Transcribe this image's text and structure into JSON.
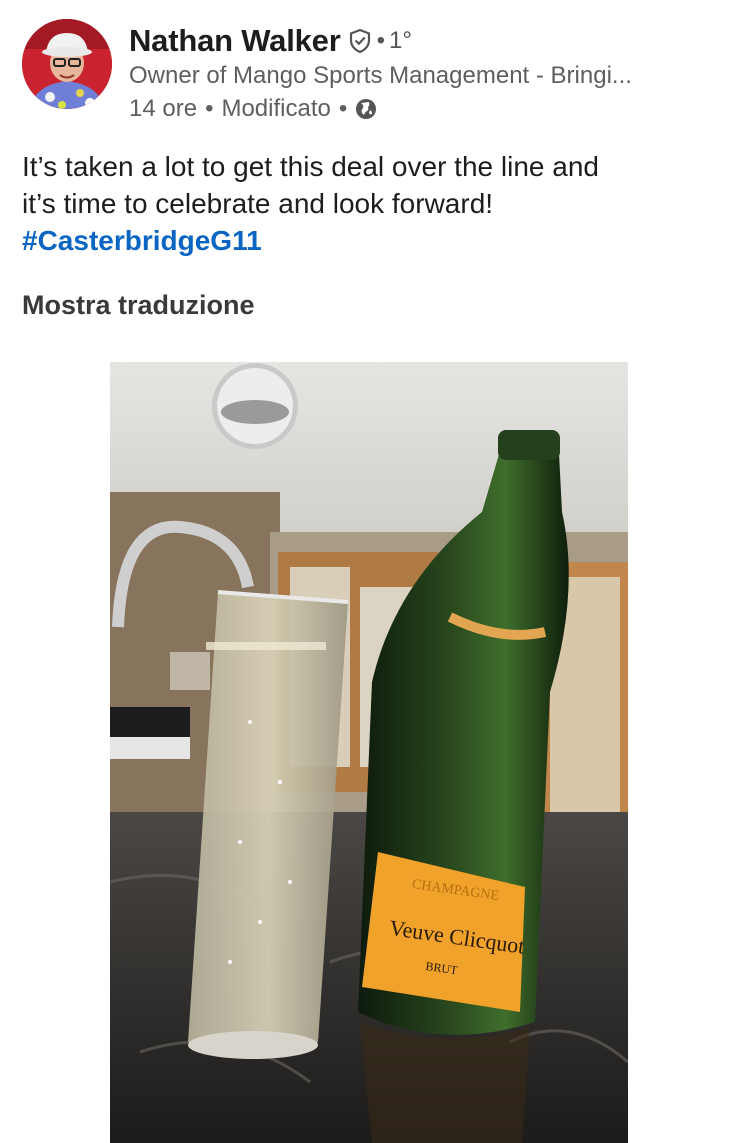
{
  "post": {
    "author": {
      "name": "Nathan Walker",
      "degree": "1°",
      "headline": "Owner of Mango Sports Management - Bringi...",
      "avatar_icon": "avatar-photo",
      "verified_icon": "verified-shield-icon"
    },
    "meta": {
      "time": "14 ore",
      "edited": "Modificato",
      "separator": "•",
      "visibility_icon": "globe-icon"
    },
    "text": {
      "line1": "It’s taken a lot to get this deal over the line and",
      "line2": "it’s time to celebrate and look forward!",
      "hashtag": "#CasterbridgeG11"
    },
    "translate_label": "Mostra traduzione",
    "photo": {
      "label_lines": [
        "CHAMPAGNE",
        "Veuve Clicquot",
        "BRUT"
      ]
    }
  },
  "colors": {
    "link": "#0a66c2",
    "text": "#1d1d1d",
    "secondary": "#5e5e5e",
    "label_orange": "#f0a22a"
  }
}
